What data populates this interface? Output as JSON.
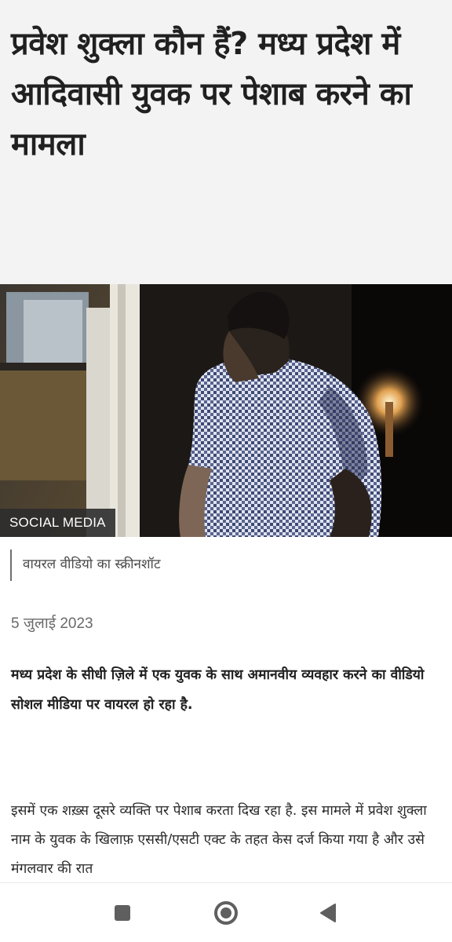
{
  "article": {
    "headline": "प्रवेश शुक्ला कौन हैं? मध्य प्रदेश में आदिवासी युवक पर पेशाब करने का मामला",
    "image_credit": "SOCIAL MEDIA",
    "image_caption": "वायरल वीडियो का स्क्रीनशॉट",
    "date": "5 जुलाई 2023",
    "summary": "मध्य प्रदेश के सीधी ज़िले में एक युवक के साथ अमानवीय व्यवहार करने का वीडियो सोशल मीडिया पर वायरल हो रहा है.",
    "body": "इसमें एक शख़्स दूसरे व्यक्ति पर पेशाब करता दिख रहा है. इस मामले में प्रवेश शुक्ला नाम के युवक के खिलाफ़ एससी/एसटी एक्ट के तहत केस दर्ज किया गया है और उसे मंगलवार की रात"
  },
  "navbar": {
    "recents_icon": "square-recents-icon",
    "home_icon": "circle-home-icon",
    "back_icon": "triangle-back-icon",
    "color": "#5f5f5f"
  }
}
